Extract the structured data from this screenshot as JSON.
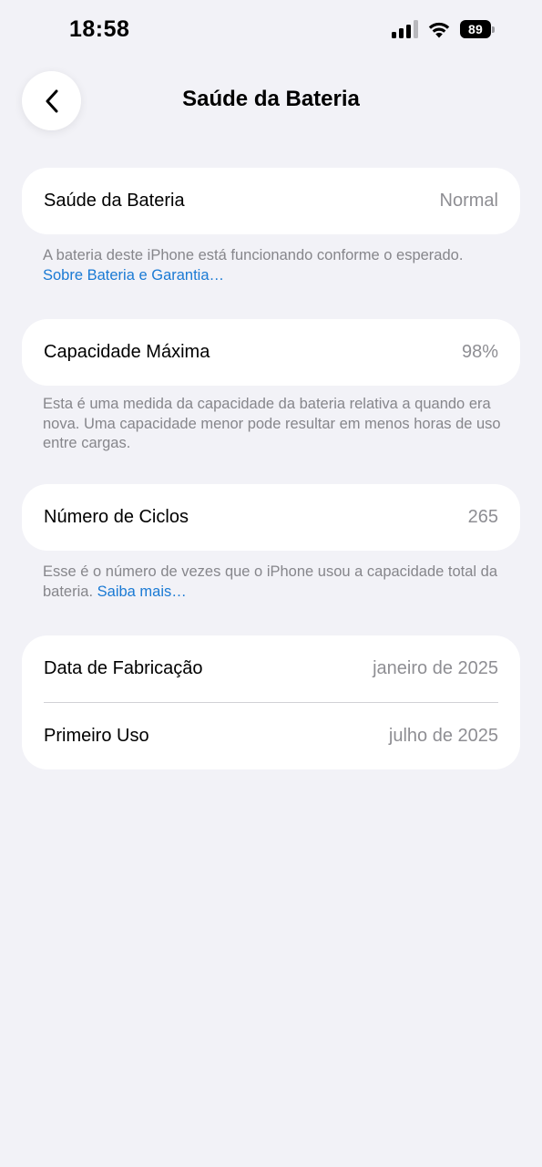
{
  "status_bar": {
    "time": "18:58",
    "battery_level": "89"
  },
  "nav": {
    "title": "Saúde da Bateria",
    "back_icon": "chevron-left-icon"
  },
  "sections": {
    "health": {
      "label": "Saúde da Bateria",
      "value": "Normal",
      "footnote": "A bateria deste iPhone está funcionando conforme o esperado.",
      "link": "Sobre Bateria e Garantia…"
    },
    "capacity": {
      "label": "Capacidade Máxima",
      "value": "98%",
      "footnote": "Esta é uma medida da capacidade da bateria relativa a quando era nova. Uma capacidade menor pode resultar em menos horas de uso entre cargas."
    },
    "cycles": {
      "label": "Número de Ciclos",
      "value": "265",
      "footnote": "Esse é o número de vezes que o iPhone usou a capacidade total da bateria.",
      "link": "Saiba mais…"
    },
    "dates": {
      "manufacture_label": "Data de Fabricação",
      "manufacture_value": "janeiro de 2025",
      "first_use_label": "Primeiro Uso",
      "first_use_value": "julho de 2025"
    }
  },
  "colors": {
    "background": "#f2f2f7",
    "card": "#ffffff",
    "link": "#1a7ad4",
    "secondary_text": "#8e8e93"
  }
}
